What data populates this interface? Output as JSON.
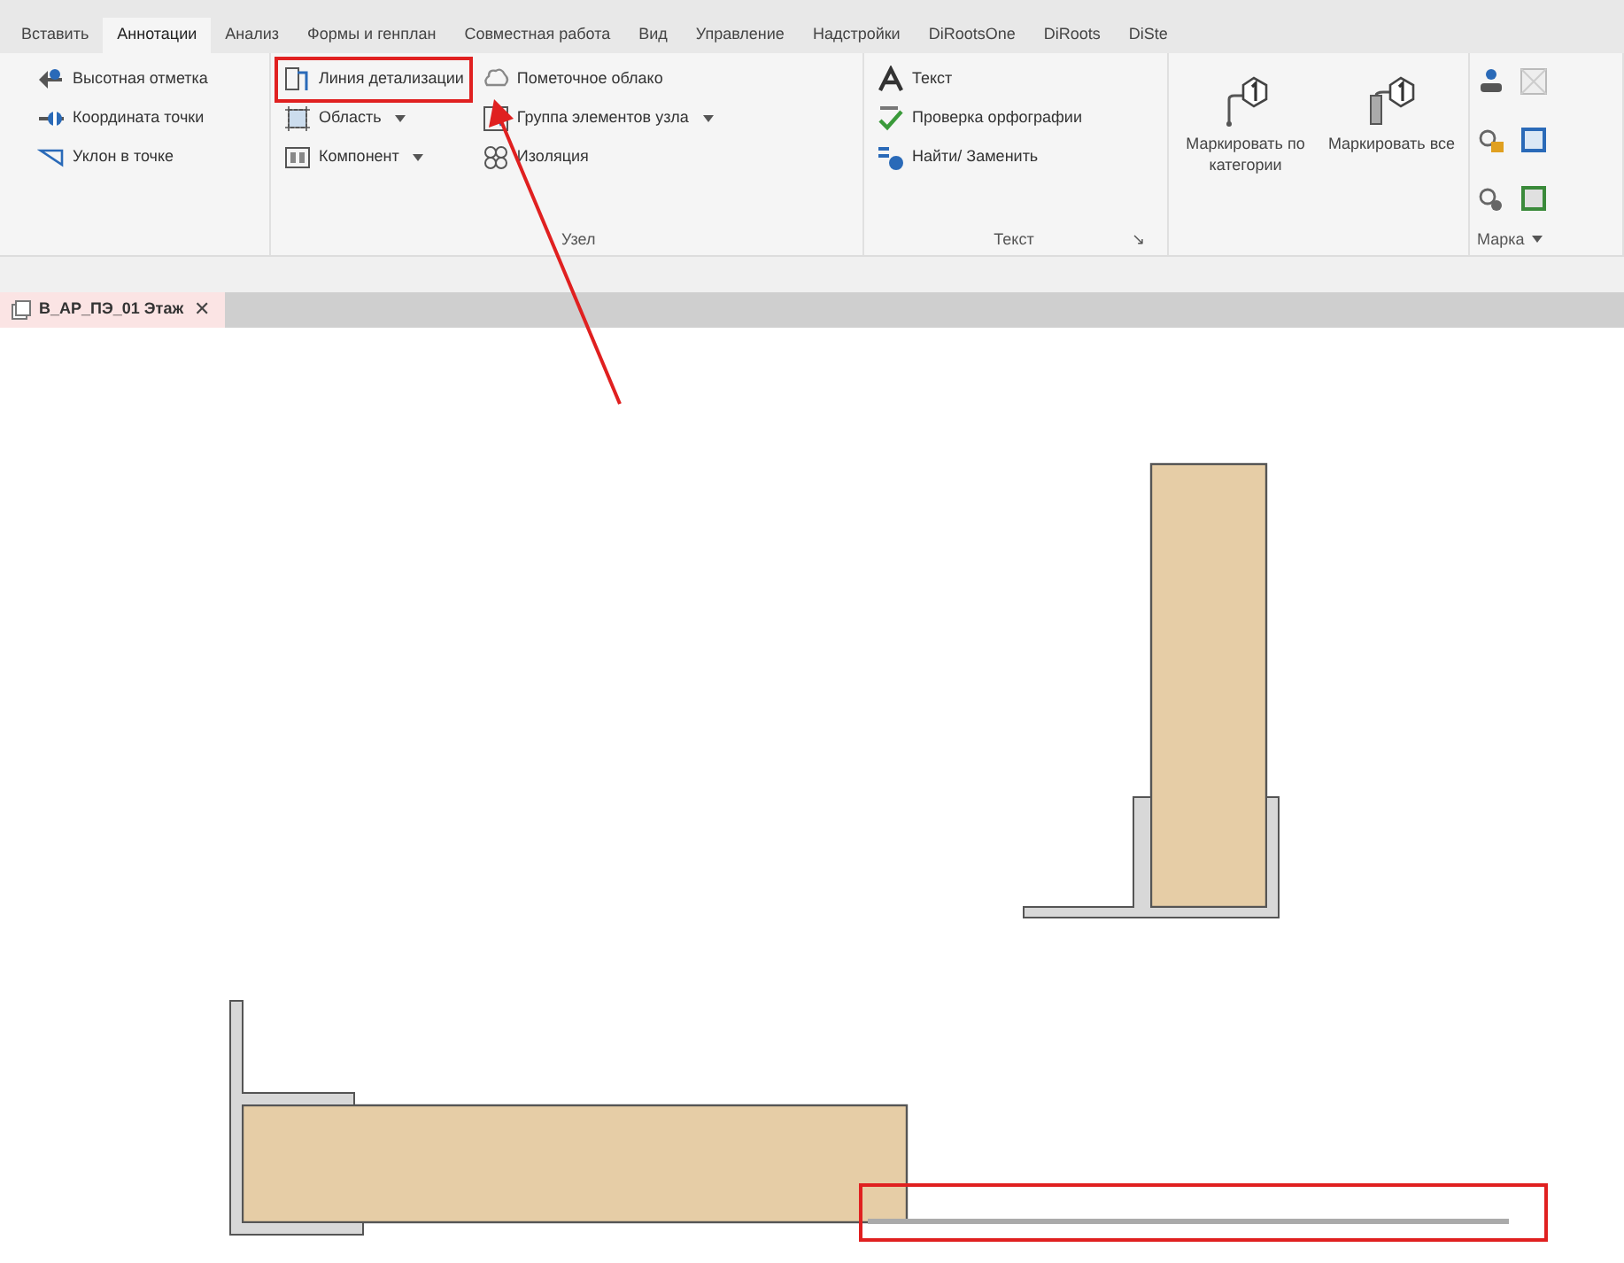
{
  "ribbon_tabs": [
    {
      "label": "Вставить",
      "selected": false
    },
    {
      "label": "Аннотации",
      "selected": true
    },
    {
      "label": "Анализ",
      "selected": false
    },
    {
      "label": "Формы и генплан",
      "selected": false
    },
    {
      "label": "Совместная работа",
      "selected": false
    },
    {
      "label": "Вид",
      "selected": false
    },
    {
      "label": "Управление",
      "selected": false
    },
    {
      "label": "Надстройки",
      "selected": false
    },
    {
      "label": "DiRootsOne",
      "selected": false
    },
    {
      "label": "DiRoots",
      "selected": false
    },
    {
      "label": "DiSte",
      "selected": false
    }
  ],
  "panels": [
    {
      "kind": "small",
      "columns": [
        [
          {
            "label": "Высотная отметка",
            "dropdown": false,
            "highlighted": false
          },
          {
            "label": "Координата точки",
            "dropdown": false,
            "highlighted": false
          },
          {
            "label": "Уклон в точке",
            "dropdown": false,
            "highlighted": false
          }
        ]
      ]
    },
    {
      "kind": "small",
      "title": "Узел",
      "columns": [
        [
          {
            "label": "Линия детализации",
            "dropdown": false,
            "highlighted": true
          },
          {
            "label": "Область",
            "dropdown": true,
            "highlighted": false
          },
          {
            "label": "Компонент",
            "dropdown": true,
            "highlighted": false
          }
        ],
        [
          {
            "label": "Пометочное облако",
            "dropdown": false,
            "highlighted": false
          },
          {
            "label": "Группа элементов узла",
            "dropdown": true,
            "highlighted": false
          },
          {
            "label": "Изоляция",
            "dropdown": false,
            "highlighted": false
          }
        ]
      ]
    },
    {
      "kind": "small",
      "title": "Текст",
      "launcher": "↘",
      "columns": [
        [
          {
            "label": "Текст",
            "dropdown": false,
            "highlighted": false
          },
          {
            "label": "Проверка орфографии",
            "dropdown": false,
            "highlighted": false
          },
          {
            "label": "Найти/ Заменить",
            "dropdown": false,
            "highlighted": false
          }
        ]
      ]
    },
    {
      "kind": "large",
      "buttons": [
        {
          "label": "Маркировать по категории"
        },
        {
          "label": "Маркировать все"
        }
      ]
    },
    {
      "kind": "icons",
      "title": "Марка",
      "title_dropdown": true
    }
  ],
  "document_tab": {
    "title": "B_АР_ПЭ_01 Этаж",
    "close": "✕"
  },
  "canvas": {
    "detail_line": {
      "highlighted": true
    }
  }
}
